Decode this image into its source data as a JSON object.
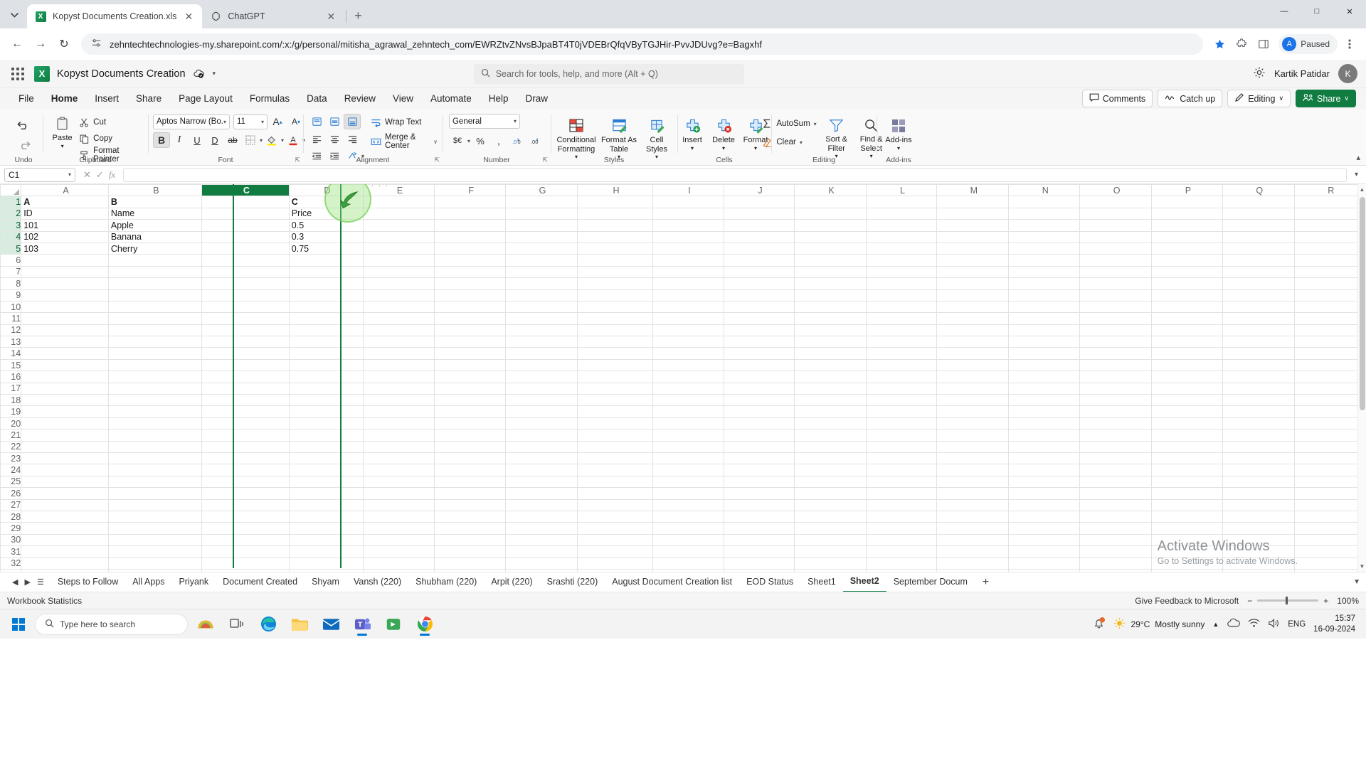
{
  "browser": {
    "tabs": [
      {
        "title": "Kopyst Documents Creation.xls",
        "favicon": "excel-icon",
        "active": true
      },
      {
        "title": "ChatGPT",
        "favicon": "chatgpt-icon",
        "active": false
      }
    ],
    "new_tab_label": "+",
    "tab_search_icon": "chevron-down-icon",
    "nav": {
      "back": "←",
      "forward": "→",
      "reload": "↻"
    },
    "url": "zehntechtechnologies-my.sharepoint.com/:x:/g/personal/mitisha_agrawal_zehntech_com/EWRZtvZNvsBJpaBT4T0jVDEBrQfqVByTGJHir-PvvJDUvg?e=Bagxhf",
    "site_settings_icon": "tune-icon",
    "star_icon": "bookmark-star-icon",
    "extensions_icon": "puzzle-icon",
    "sidepanel_icon": "side-panel-icon",
    "profile_label": "Paused",
    "profile_initial": "A",
    "menu_icon": "three-dot-menu-icon",
    "window_controls": {
      "minimize": "—",
      "maximize": "□",
      "close": "✕"
    }
  },
  "app_header": {
    "waffle_icon": "app-launcher-icon",
    "app_icon": "excel-icon",
    "app_icon_letter": "X",
    "document_title": "Kopyst Documents Creation",
    "autosave_icon": "autosave-cloud-icon",
    "title_chevron": "chevron-down-icon",
    "search_placeholder": "Search for tools, help, and more (Alt + Q)",
    "search_icon": "search-icon",
    "settings_icon": "gear-icon",
    "user_name": "Kartik Patidar",
    "user_initial": "K"
  },
  "ribbon_tabs": {
    "items": [
      "File",
      "Home",
      "Insert",
      "Share",
      "Page Layout",
      "Formulas",
      "Data",
      "Review",
      "View",
      "Automate",
      "Help",
      "Draw"
    ],
    "active": "Home",
    "right_buttons": [
      {
        "label": "Comments",
        "icon": "comment-icon"
      },
      {
        "label": "Catch up",
        "icon": "catchup-icon"
      },
      {
        "label": "Editing",
        "icon": "pencil-icon",
        "chevron": "∨"
      },
      {
        "label": "Share",
        "icon": "share-people-icon",
        "chevron": "∨",
        "accent": true
      }
    ]
  },
  "ribbon": {
    "collapse_icon": "chevron-up-icon",
    "groups": [
      {
        "name": "Undo",
        "label": "Undo",
        "buttons": [
          {
            "label": "",
            "icon": "undo-icon"
          },
          {
            "label": "",
            "icon": "redo-icon"
          }
        ]
      },
      {
        "name": "Clipboard",
        "label": "Clipboard",
        "paste_label": "Paste",
        "paste_icon": "paste-icon",
        "items": [
          {
            "label": "Cut",
            "icon": "scissors-icon"
          },
          {
            "label": "Copy",
            "icon": "copy-icon"
          },
          {
            "label": "Format Painter",
            "icon": "format-painter-icon"
          }
        ]
      },
      {
        "name": "Font",
        "label": "Font",
        "font_name": "Aptos Narrow (Bo...",
        "font_size": "11",
        "grow_icon": "increase-font-size-icon",
        "shrink_icon": "decrease-font-size-icon",
        "bold": "B",
        "italic": "I",
        "underline": "U",
        "double_underline": "D",
        "strikethrough": "ab",
        "borders_icon": "borders-icon",
        "fill_color_icon": "fill-color-icon",
        "font_color_icon": "font-color-icon",
        "launcher_icon": "dialog-launcher-icon"
      },
      {
        "name": "Alignment",
        "label": "Alignment",
        "wrap_text": "Wrap Text",
        "wrap_icon": "wrap-text-icon",
        "merge_center": "Merge & Center",
        "merge_icon": "merge-cells-icon",
        "merge_chevron": "∨",
        "align_top_icon": "align-top-icon",
        "align_middle_icon": "align-middle-icon",
        "align_bottom_icon": "align-bottom-icon",
        "align_left_icon": "align-left-icon",
        "align_center_icon": "align-center-icon",
        "align_right_icon": "align-right-icon",
        "decrease_indent_icon": "decrease-indent-icon",
        "increase_indent_icon": "increase-indent-icon",
        "orientation_icon": "text-orientation-icon",
        "launcher_icon": "dialog-launcher-icon"
      },
      {
        "name": "Number",
        "label": "Number",
        "format": "General",
        "currency_icon": "currency-icon",
        "percent_icon": "percent-icon",
        "comma_icon": "comma-style-icon",
        "increase_decimal_icon": "increase-decimal-icon",
        "decrease_decimal_icon": "decrease-decimal-icon",
        "launcher_icon": "dialog-launcher-icon"
      },
      {
        "name": "Styles",
        "label": "Styles",
        "buttons": [
          {
            "label": "Conditional Formatting",
            "icon": "conditional-formatting-icon",
            "chevron": "∨"
          },
          {
            "label": "Format As Table",
            "icon": "format-as-table-icon",
            "chevron": "∨"
          },
          {
            "label": "Cell Styles",
            "icon": "cell-styles-icon",
            "chevron": "∨"
          }
        ]
      },
      {
        "name": "Cells",
        "label": "Cells",
        "buttons": [
          {
            "label": "Insert",
            "icon": "insert-cells-icon",
            "chevron": "∨"
          },
          {
            "label": "Delete",
            "icon": "delete-cells-icon",
            "chevron": "∨"
          },
          {
            "label": "Format",
            "icon": "format-cells-icon",
            "chevron": "∨"
          }
        ]
      },
      {
        "name": "Editing",
        "label": "Editing",
        "items": [
          {
            "label": "AutoSum",
            "icon": "autosum-icon",
            "chevron": "∨"
          },
          {
            "label": "Clear",
            "icon": "clear-icon",
            "chevron": "∨"
          }
        ],
        "buttons": [
          {
            "label": "Sort & Filter",
            "icon": "sort-filter-icon",
            "chevron": "∨"
          },
          {
            "label": "Find & Select",
            "icon": "find-select-icon",
            "chevron": "∨"
          }
        ]
      },
      {
        "name": "Add-ins",
        "label": "Add-ins",
        "buttons": [
          {
            "label": "Add-ins",
            "icon": "addins-icon",
            "chevron": "∨"
          }
        ]
      }
    ]
  },
  "formula_bar": {
    "name_box": "C1",
    "name_box_chevron": "chevron-down-icon",
    "cancel_icon": "cancel-icon",
    "enter_icon": "confirm-check-icon",
    "function_icon": "insert-function-icon",
    "value": "",
    "expand_icon": "chevron-down-icon"
  },
  "grid": {
    "columns": [
      "A",
      "B",
      "C",
      "D",
      "E",
      "F",
      "G",
      "H",
      "I",
      "J",
      "K",
      "L",
      "M",
      "N",
      "O",
      "P",
      "Q",
      "R"
    ],
    "selected_column": "C",
    "row_count": 33,
    "rows": [
      {
        "n": 1,
        "cells": {
          "A": "A",
          "B": "B",
          "C": "",
          "D": "C"
        },
        "bold": true
      },
      {
        "n": 2,
        "cells": {
          "A": "ID",
          "B": "Name",
          "C": "",
          "D": "Price"
        }
      },
      {
        "n": 3,
        "cells": {
          "A": "101",
          "B": "Apple",
          "C": "",
          "D": "0.5"
        }
      },
      {
        "n": 4,
        "cells": {
          "A": "102",
          "B": "Banana",
          "C": "",
          "D": "0.3"
        }
      },
      {
        "n": 5,
        "cells": {
          "A": "103",
          "B": "Cherry",
          "C": "",
          "D": "0.75"
        }
      }
    ],
    "watermark_title": "Activate Windows",
    "watermark_sub": "Go to Settings to activate Windows."
  },
  "sheet_bar": {
    "nav_icons": [
      "first-sheet-icon",
      "prev-sheet-icon",
      "next-sheet-icon",
      "last-sheet-icon"
    ],
    "tabs": [
      "Steps to Follow",
      "All Apps",
      "Priyank",
      "Document Created",
      "Shyam",
      "Vansh (220)",
      "Shubham (220)",
      "Arpit (220)",
      "Srashti (220)",
      "August Document Creation list",
      "EOD Status",
      "Sheet1",
      "Sheet2",
      "September Docum"
    ],
    "active_tab": "Sheet2",
    "add_sheet_label": "+",
    "scroll_right_icon": "chevron-right-icon"
  },
  "status_bar": {
    "left_label": "Workbook Statistics",
    "feedback_label": "Give Feedback to Microsoft",
    "zoom_out": "−",
    "zoom_in": "+",
    "zoom_level": "100%"
  },
  "taskbar": {
    "start_icon": "windows-start-icon",
    "search_placeholder": "Type here to search",
    "search_icon": "search-icon",
    "apps": [
      {
        "name": "taco-widget-icon"
      },
      {
        "name": "task-view-icon"
      },
      {
        "name": "edge-icon"
      },
      {
        "name": "file-explorer-icon"
      },
      {
        "name": "mail-icon"
      },
      {
        "name": "teams-icon",
        "running": true
      },
      {
        "name": "store-icon"
      },
      {
        "name": "chrome-icon",
        "running": true
      }
    ],
    "weather_temp": "29°C",
    "weather_desc": "Mostly sunny",
    "weather_icon": "sun-icon",
    "tray_icons": [
      "chevron-up-icon",
      "onedrive-icon",
      "network-icon",
      "battery-icon",
      "volume-icon"
    ],
    "language": "ENG",
    "time": "15:37",
    "date": "16-09-2024",
    "notification_icon": "notification-bell-icon"
  },
  "colors": {
    "excel_green": "#107c41",
    "selection_fill": "#dfeee5",
    "chrome_tabstrip": "#dee1e6",
    "accent_blue": "#0078d4"
  }
}
